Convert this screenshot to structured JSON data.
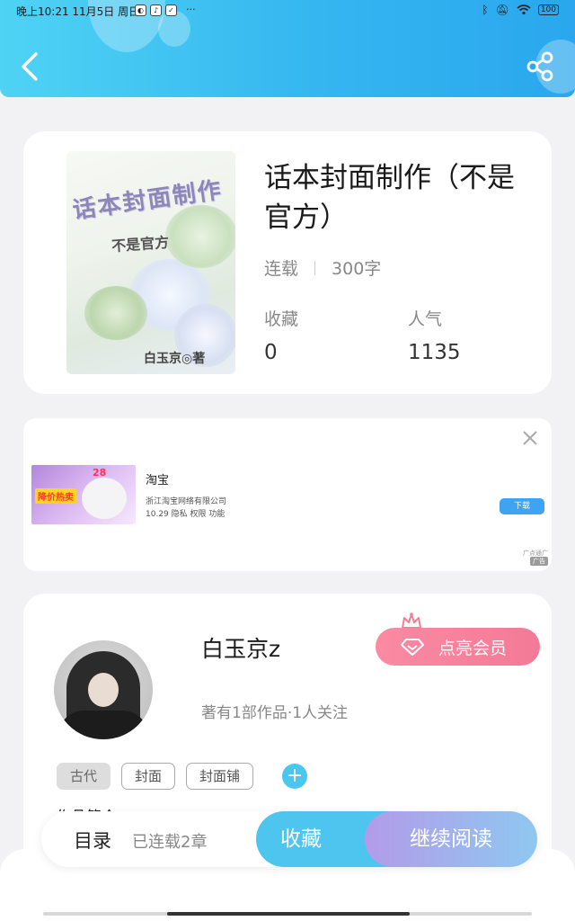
{
  "status_bar": {
    "time_text": "晚上10:21 11月5日 周日",
    "more_dots": "···",
    "battery": "100"
  },
  "book": {
    "title": "话本封面制作（不是官方）",
    "status": "连载",
    "word_count": "300字",
    "favorites_label": "收藏",
    "favorites_value": "0",
    "popularity_label": "人气",
    "popularity_value": "1135",
    "cover": {
      "title_art": "话本封面制作",
      "subtitle_art": "不是官方",
      "author_art": "白玉京◎著"
    }
  },
  "ad": {
    "app_name": "淘宝",
    "company": "浙江淘宝网络有限公司",
    "info": "10.29 隐私 权限 功能",
    "download_label": "下载",
    "ad_tag": "广告",
    "ad_source": "广点通广",
    "image_tag": "降价热卖",
    "image_number": "28"
  },
  "author": {
    "name": "白玉京z",
    "stats": "著有1部作品·1人关注",
    "vip_label": "点亮会员",
    "tags": [
      "古代",
      "封面",
      "封面铺"
    ],
    "add_tag": "+",
    "intro_peek": "作品简介"
  },
  "bottom_bar": {
    "toc_label": "目录",
    "chapters_label": "已连载2章",
    "collect_label": "收藏",
    "continue_label": "继续阅读"
  },
  "colors": {
    "header_gradient_start": "#4fd3f4",
    "header_gradient_end": "#2aa7ee",
    "vip_pink": "#f37a97",
    "accent_blue": "#4dc5ef",
    "continue_gradient_start": "#b39be9"
  },
  "icons": [
    "back-arrow-icon",
    "share-icon",
    "close-icon",
    "crown-icon",
    "diamond-icon",
    "plus-icon"
  ]
}
